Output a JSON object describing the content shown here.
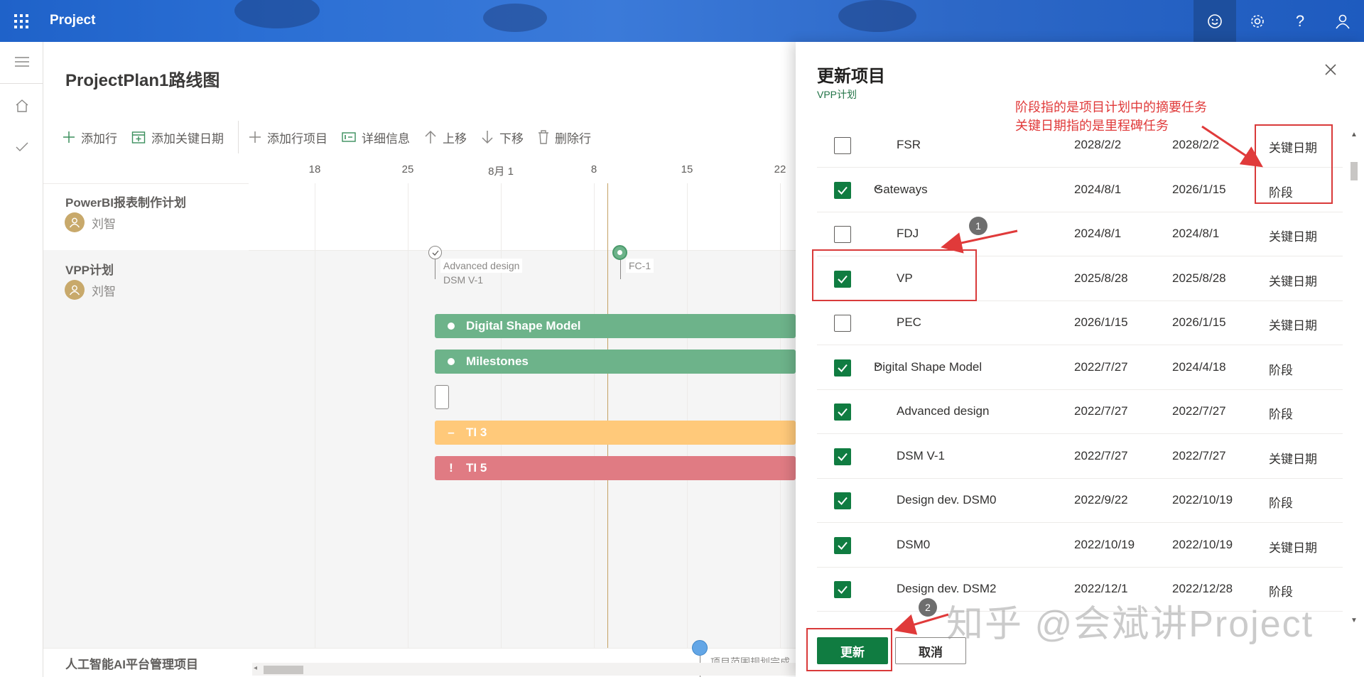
{
  "app": {
    "name": "Project"
  },
  "header": {
    "feedback": "feedback-icon",
    "settings": "gear-icon",
    "help": "?",
    "account": "person-icon"
  },
  "page": {
    "title": "ProjectPlan1路线图"
  },
  "commands": {
    "add_row": "添加行",
    "add_key_date": "添加关键日期",
    "add_row_item": "添加行项目",
    "details": "详细信息",
    "move_up": "上移",
    "move_down": "下移",
    "delete_row": "删除行"
  },
  "timeline": {
    "ticks": [
      "18",
      "25",
      "8月 1",
      "8",
      "15",
      "22"
    ]
  },
  "rows": [
    {
      "name": "PowerBI报表制作计划",
      "owner": "刘智"
    },
    {
      "name": "VPP计划",
      "owner": "刘智"
    },
    {
      "name": "人工智能AI平台管理项目",
      "owner": ""
    }
  ],
  "roadmap": {
    "milestones": [
      "Advanced design",
      "DSM V-1",
      "FC-1",
      "项目范围规划完成"
    ],
    "bars": [
      {
        "label": "Digital Shape Model",
        "status": "dot",
        "color": "#6db38a"
      },
      {
        "label": "Milestones",
        "status": "dot",
        "color": "#6db38a"
      },
      {
        "label": "TI 3",
        "status": "–",
        "color": "#ffc97a"
      },
      {
        "label": "TI 5",
        "status": "!",
        "color": "#e07b83"
      }
    ]
  },
  "panel": {
    "title": "更新项目",
    "subtitle": "VPP计划",
    "items": [
      {
        "name": "FSR",
        "start": "2028/2/2",
        "finish": "2028/2/2",
        "type": "关键日期",
        "checked": false,
        "group": false
      },
      {
        "name": "Gateways",
        "start": "2024/8/1",
        "finish": "2026/1/15",
        "type": "阶段",
        "checked": true,
        "group": true
      },
      {
        "name": "FDJ",
        "start": "2024/8/1",
        "finish": "2024/8/1",
        "type": "关键日期",
        "checked": false,
        "group": false
      },
      {
        "name": "VP",
        "start": "2025/8/28",
        "finish": "2025/8/28",
        "type": "关键日期",
        "checked": true,
        "group": false
      },
      {
        "name": "PEC",
        "start": "2026/1/15",
        "finish": "2026/1/15",
        "type": "关键日期",
        "checked": false,
        "group": false
      },
      {
        "name": "Digital Shape Model",
        "start": "2022/7/27",
        "finish": "2024/4/18",
        "type": "阶段",
        "checked": true,
        "group": true
      },
      {
        "name": "Advanced design",
        "start": "2022/7/27",
        "finish": "2022/7/27",
        "type": "阶段",
        "checked": true,
        "group": false
      },
      {
        "name": "DSM V-1",
        "start": "2022/7/27",
        "finish": "2022/7/27",
        "type": "关键日期",
        "checked": true,
        "group": false
      },
      {
        "name": "Design dev. DSM0",
        "start": "2022/9/22",
        "finish": "2022/10/19",
        "type": "阶段",
        "checked": true,
        "group": false
      },
      {
        "name": "DSM0",
        "start": "2022/10/19",
        "finish": "2022/10/19",
        "type": "关键日期",
        "checked": true,
        "group": false
      },
      {
        "name": "Design dev. DSM2",
        "start": "2022/12/1",
        "finish": "2022/12/28",
        "type": "阶段",
        "checked": true,
        "group": false
      }
    ],
    "update_button": "更新",
    "cancel_button": "取消"
  },
  "annotations": {
    "note_line1": "阶段指的是项目计划中的摘要任务",
    "note_line2": "关键日期指的是里程碑任务",
    "badge1": "1",
    "badge2": "2",
    "watermark": "知乎 @会斌讲Project",
    "color": "#e03a3a"
  }
}
